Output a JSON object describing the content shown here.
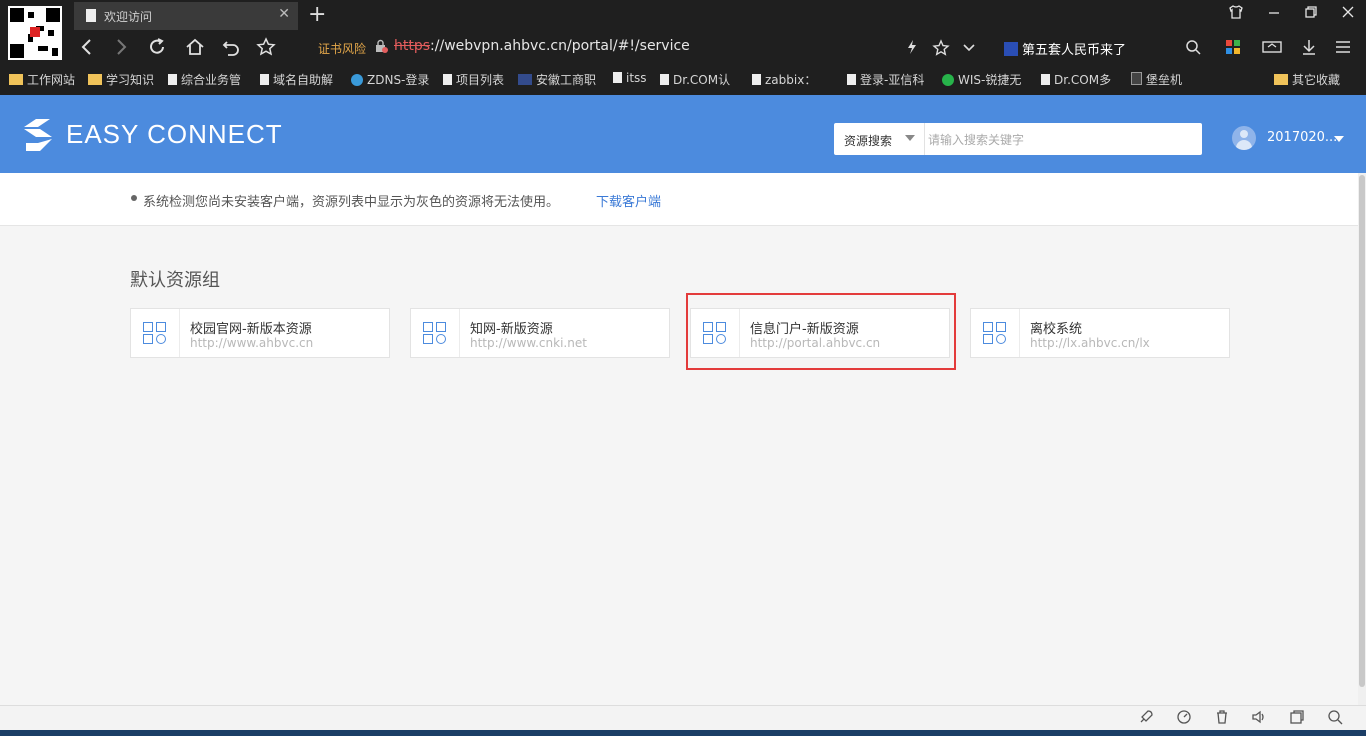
{
  "browser": {
    "tab_title": "欢迎访问",
    "tab_close": "✕",
    "new_tab": "+",
    "window_controls": [
      "shirt-icon",
      "minimize-icon",
      "restore-icon",
      "close-icon"
    ],
    "nav_icons": [
      "back-icon",
      "forward-icon",
      "refresh-icon",
      "home-icon",
      "undo-icon",
      "star-icon"
    ],
    "address": {
      "security_warning": "证书风险",
      "scheme": "https",
      "rest": "://webvpn.ahbvc.cn/portal/#!/service"
    },
    "news": "第五套人民币来了",
    "bookmarks": [
      {
        "label": "工作网站",
        "kind": "folder"
      },
      {
        "label": "学习知识",
        "kind": "folder"
      },
      {
        "label": "综合业务管",
        "kind": "doc"
      },
      {
        "label": "域名自助解",
        "kind": "doc"
      },
      {
        "label": "ZDNS-登录",
        "kind": "dot",
        "color": "#3a9ad9"
      },
      {
        "label": "项目列表",
        "kind": "doc"
      },
      {
        "label": "安徽工商职",
        "kind": "doc"
      },
      {
        "label": "itss",
        "kind": "doc"
      },
      {
        "label": "Dr.COM认",
        "kind": "doc"
      },
      {
        "label": "zabbix：",
        "kind": "doc"
      },
      {
        "label": "登录-亚信科",
        "kind": "doc"
      },
      {
        "label": "WIS-锐捷无",
        "kind": "dot",
        "color": "#27b34a"
      },
      {
        "label": "Dr.COM多",
        "kind": "doc"
      },
      {
        "label": "堡垒机",
        "kind": "doc"
      },
      {
        "label": "其它收藏",
        "kind": "folder"
      }
    ]
  },
  "header": {
    "logo_text": "EASY CONNECT",
    "search_type": "资源搜索",
    "search_placeholder": "请输入搜索关键字",
    "search_value": "",
    "username": "2017020..."
  },
  "notice": {
    "text": "系统检测您尚未安装客户端，资源列表中显示为灰色的资源将无法使用。",
    "link": "下载客户端"
  },
  "resources": {
    "group_title": "默认资源组",
    "items": [
      {
        "name": "校园官网-新版本资源",
        "url": "http://www.ahbvc.cn"
      },
      {
        "name": "知网-新版资源",
        "url": "http://www.cnki.net"
      },
      {
        "name": "信息门户-新版资源",
        "url": "http://portal.ahbvc.cn"
      },
      {
        "name": "离校系统",
        "url": "http://lx.ahbvc.cn/lx"
      }
    ]
  },
  "colors": {
    "header_bg": "#4c8bde",
    "link": "#3a79d6",
    "highlight": "#e33b3b"
  }
}
